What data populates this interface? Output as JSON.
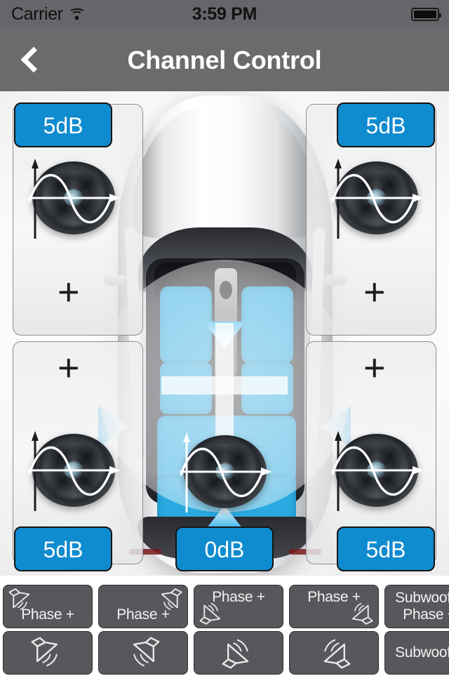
{
  "status_bar": {
    "carrier": "Carrier",
    "wifi_icon": "wifi-icon",
    "time": "3:59 PM",
    "battery_icon": "battery-full-icon"
  },
  "nav_bar": {
    "back_icon": "chevron-left-icon",
    "title": "Channel Control"
  },
  "stage": {
    "car_image": "car-top-view-illustration",
    "fader": {
      "name": "balance-fader-joystick",
      "arrows": [
        "arrow-up",
        "arrow-down",
        "arrow-left",
        "arrow-right"
      ],
      "accent_color": "#1aa7e8"
    },
    "channels": [
      {
        "id": "front-left",
        "db": "5dB",
        "plus": "+",
        "speaker_icon": "woofer-icon"
      },
      {
        "id": "front-right",
        "db": "5dB",
        "plus": "+",
        "speaker_icon": "woofer-icon"
      },
      {
        "id": "rear-left",
        "db": "5dB",
        "plus": "+",
        "speaker_icon": "woofer-icon"
      },
      {
        "id": "rear-right",
        "db": "5dB",
        "plus": "+",
        "speaker_icon": "woofer-icon"
      },
      {
        "id": "subwoofer",
        "db": "0dB",
        "speaker_icon": "woofer-icon"
      }
    ],
    "badge_color": "#0f8bd0"
  },
  "buttons": {
    "phase_row": [
      {
        "label": "Phase +",
        "icon": "speaker-front-left-icon",
        "icon_pos": "top-left",
        "label_pos": "bottom"
      },
      {
        "label": "Phase +",
        "icon": "speaker-front-right-icon",
        "icon_pos": "top-right",
        "label_pos": "bottom"
      },
      {
        "label": "Phase +",
        "icon": "speaker-rear-left-icon",
        "icon_pos": "bottom-left",
        "label_pos": "top"
      },
      {
        "label": "Phase +",
        "icon": "speaker-rear-right-icon",
        "icon_pos": "bottom-right",
        "label_pos": "top"
      },
      {
        "label": "Subwoofer Phase +",
        "label_line1": "Subwoofer",
        "label_line2": "Phase +"
      }
    ],
    "speaker_row": [
      {
        "icon": "speaker-front-left-icon",
        "label": ""
      },
      {
        "icon": "speaker-front-right-icon",
        "label": ""
      },
      {
        "icon": "speaker-rear-left-icon",
        "label": ""
      },
      {
        "icon": "speaker-rear-right-icon",
        "label": ""
      },
      {
        "label": "Subwoofer"
      }
    ],
    "button_color": "#57585c"
  }
}
